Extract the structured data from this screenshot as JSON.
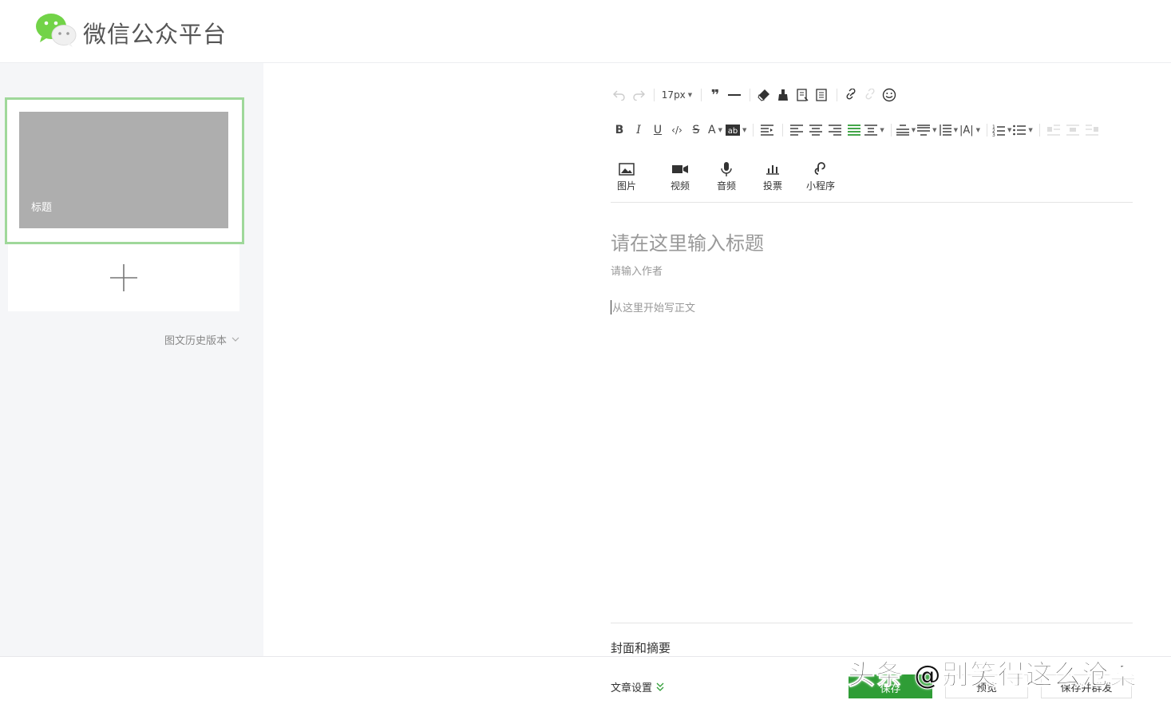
{
  "header": {
    "title": "微信公众平台"
  },
  "left": {
    "card_title": "标题",
    "history_label": "图文历史版本"
  },
  "toolbar": {
    "font_size": "17px"
  },
  "insert": {
    "image": "图片",
    "video": "视频",
    "audio": "音频",
    "vote": "投票",
    "miniprogram": "小程序"
  },
  "editor": {
    "title_placeholder": "请在这里输入标题",
    "author_placeholder": "请输入作者",
    "body_placeholder": "从这里开始写正文"
  },
  "cover_section": "封面和摘要",
  "footer": {
    "settings": "文章设置",
    "save": "保存",
    "preview": "预览",
    "publish": "保存并群发"
  },
  "watermark": "头条 @别笑得这么沧桑",
  "colors": {
    "accent": "#2f9d36",
    "card_border": "#9fd89a",
    "cover": "#aeaeae"
  }
}
